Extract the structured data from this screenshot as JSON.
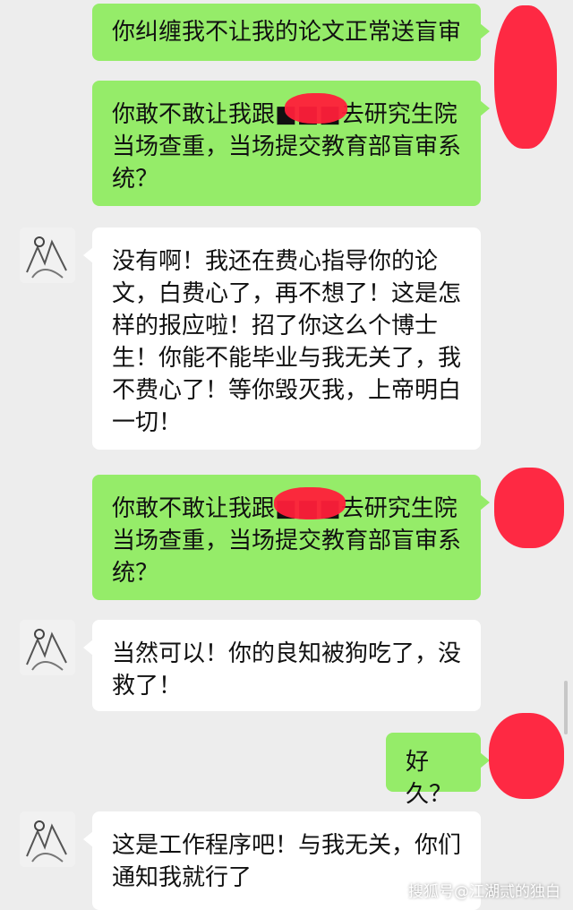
{
  "chat": {
    "messages": [
      {
        "side": "out",
        "text": "你纠缠我不让我的论文正常送盲审"
      },
      {
        "side": "out",
        "text": "你敢不敢让我跟■■■去研究生院\n当场查重，当场提交教育部盲审系\n统？"
      },
      {
        "side": "in",
        "text": "没有啊！我还在费心指导你的论\n文，白费心了，再不想了！这是怎\n样的报应啦！招了你这么个博士\n生！你能不能毕业与我无关了，我\n不费心了！等你毁灭我，上帝明白\n一切！"
      },
      {
        "side": "out",
        "text": "你敢不敢让我跟■■■去研究生院\n当场查重，当场提交教育部盲审系\n统？"
      },
      {
        "side": "in",
        "text": "当然可以！你的良知被狗吃了，没\n救了！"
      },
      {
        "side": "out",
        "text": "好久？"
      },
      {
        "side": "in",
        "text": "这是工作程序吧！与我无关，你们\n通知我就行了"
      }
    ]
  },
  "watermark": "搜狐号@江湖贰的独白",
  "colors": {
    "background": "#ededed",
    "outgoing_bubble": "#95ec69",
    "incoming_bubble": "#ffffff",
    "redaction": "#ff1f3a"
  },
  "icons": {
    "contact_avatar": "sketch-avatar-icon"
  }
}
